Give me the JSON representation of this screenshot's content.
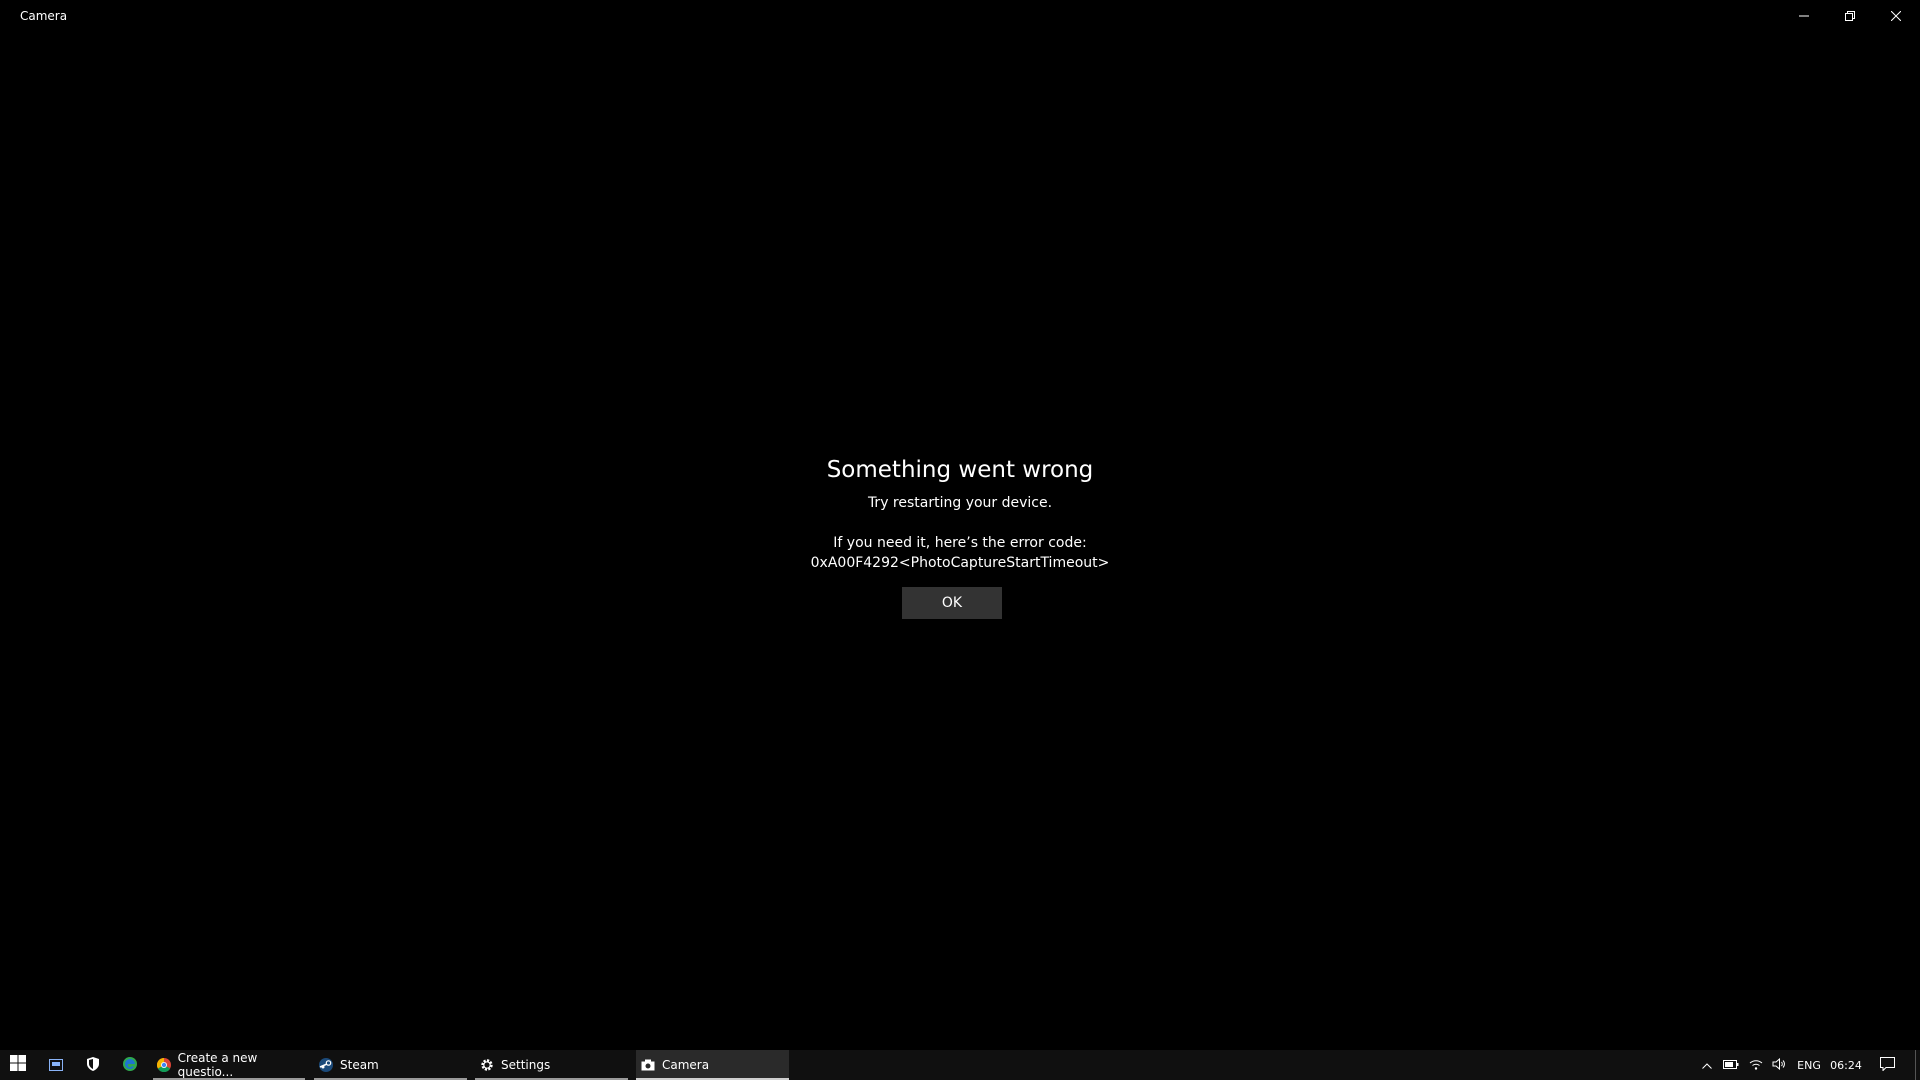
{
  "window": {
    "title": "Camera",
    "controls": {
      "minimize": "minimize-icon",
      "maximize": "restore-icon",
      "close": "close-icon"
    }
  },
  "error": {
    "title": "Something went wrong",
    "message": "Try restarting your device.",
    "code_intro": "If you need it, here’s the error code:",
    "code": "0xA00F4292<PhotoCaptureStartTimeout>",
    "ok_label": "OK"
  },
  "taskbar": {
    "start_icon": "windows-start-icon",
    "pinned_icons": [
      "task-view-icon",
      "security-shield-icon",
      "edge-icon"
    ],
    "apps": [
      {
        "label": "Create a new questio...",
        "icon": "chrome-icon",
        "active": false
      },
      {
        "label": "Steam",
        "icon": "steam-icon",
        "active": false
      },
      {
        "label": "Settings",
        "icon": "gear-icon",
        "active": false
      },
      {
        "label": "Camera",
        "icon": "camera-icon",
        "active": true
      }
    ],
    "tray": {
      "icons": [
        "chevron-up-icon",
        "battery-icon",
        "wifi-icon",
        "volume-icon"
      ],
      "language": "ENG",
      "time": "06:24",
      "notification_icon": "action-center-icon"
    }
  },
  "colors": {
    "background": "#000000",
    "ok_button": "#333333",
    "taskbar": "#101010"
  }
}
